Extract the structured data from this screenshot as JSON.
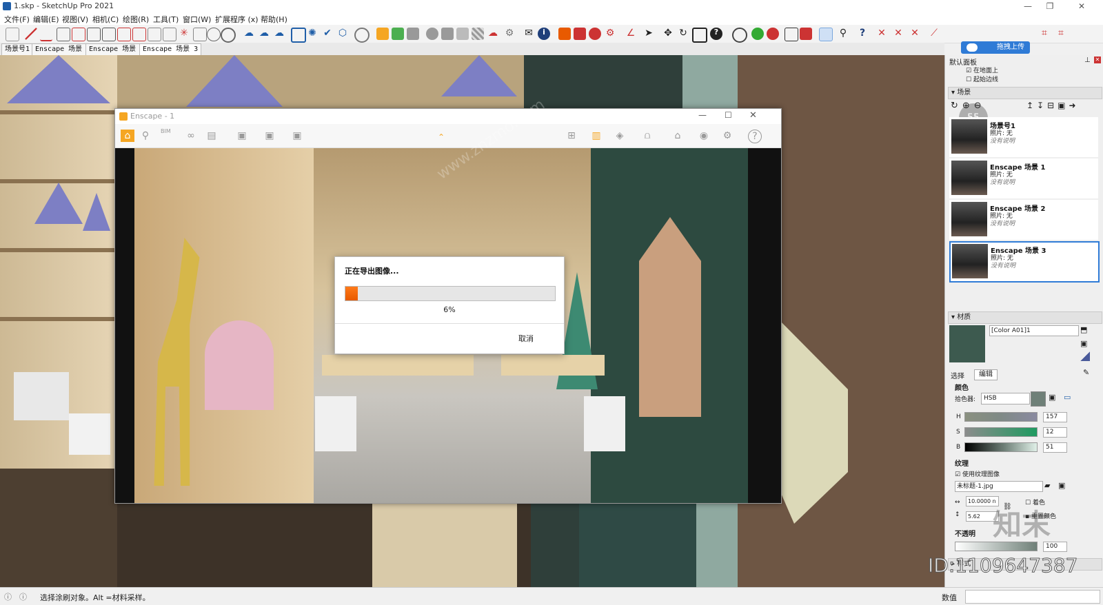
{
  "window": {
    "title": "1.skp - SketchUp Pro 2021"
  },
  "menu": [
    "文件(F)",
    "编辑(E)",
    "视图(V)",
    "相机(C)",
    "绘图(R)",
    "工具(T)",
    "窗口(W)",
    "扩展程序 (x)",
    "帮助(H)"
  ],
  "upload_button": "拖拽上传",
  "fps_badge": "55",
  "scene_tabs": [
    "场景号1",
    "Enscape 场景 1",
    "Enscape 场景 2",
    "Enscape 场景 3"
  ],
  "enscape": {
    "title": "Enscape - 1",
    "toolbar_label": "BIM",
    "progress": {
      "title": "正在导出图像...",
      "percent_text": "6%",
      "percent": 6,
      "cancel": "取消"
    }
  },
  "tray": {
    "default_panel": "默认面板",
    "checks": [
      "在地面上",
      "起始边线"
    ],
    "scenes_header": "场景",
    "scenes": [
      {
        "name": "场景号1",
        "photo": "照片: 无",
        "desc": "没有说明"
      },
      {
        "name": "Enscape 场景 1",
        "photo": "照片: 无",
        "desc": "没有说明"
      },
      {
        "name": "Enscape 场景 2",
        "photo": "照片: 无",
        "desc": "没有说明"
      },
      {
        "name": "Enscape 场景 3",
        "photo": "照片: 无",
        "desc": "没有说明"
      }
    ],
    "materials_header": "材质",
    "material_name": "[Color A01]1",
    "tab_select": "选择",
    "tab_edit": "编辑",
    "color_label": "颜色",
    "picker_label": "拾色器:",
    "picker_value": "HSB",
    "h_label": "H",
    "h_value": "157",
    "s_label": "S",
    "s_value": "12",
    "b_label": "B",
    "b_value": "51",
    "texture_label": "纹理",
    "use_texture": "使用纹理图像",
    "texture_file": "未标题-1.jpg",
    "width_value": "10.0000 n",
    "height_value": "5.62",
    "colorize": "着色",
    "reset_color": "重置颜色",
    "opacity_label": "不透明",
    "opacity_value": "100",
    "style_label": "样式"
  },
  "status": {
    "text": "选择涂刷对象。Alt =材料采样。",
    "measurements_label": "数值"
  },
  "watermark": {
    "id": "ID:1109647387",
    "brand": "知末",
    "site": "www.znzmo.com"
  },
  "colors": {
    "accent": "#ff7a1a",
    "selection": "#2f7bd6",
    "swatch": "#6f8078"
  }
}
